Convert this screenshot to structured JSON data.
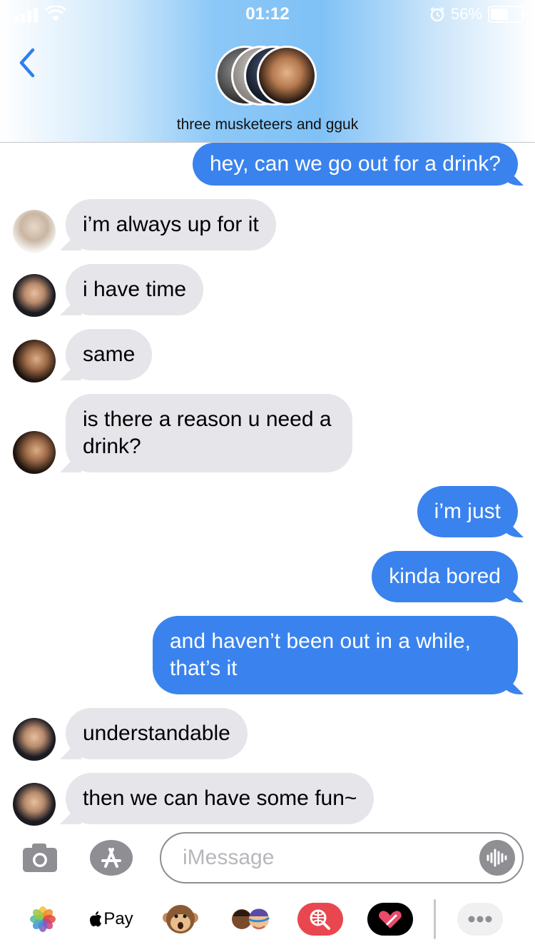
{
  "status_bar": {
    "time": "01:12",
    "battery_percent": "56%",
    "battery_level": 0.56
  },
  "header": {
    "group_title": "three musketeers and gguk"
  },
  "messages": [
    {
      "direction": "outgoing",
      "text": "hey, can we go out for a drink?"
    },
    {
      "direction": "incoming",
      "text": "i’m always up for it"
    },
    {
      "direction": "incoming",
      "text": "i have time"
    },
    {
      "direction": "incoming",
      "text": "same"
    },
    {
      "direction": "incoming",
      "text": "is there a reason u need a drink?"
    },
    {
      "direction": "outgoing",
      "text": "i’m just"
    },
    {
      "direction": "outgoing",
      "text": "kinda bored"
    },
    {
      "direction": "outgoing",
      "text": "and haven’t been out in a while, that’s it"
    },
    {
      "direction": "incoming",
      "text": "understandable"
    },
    {
      "direction": "incoming",
      "text": "then we can have some fun~"
    }
  ],
  "input_bar": {
    "placeholder": "iMessage",
    "value": ""
  },
  "app_drawer": {
    "apple_pay_label": "Pay",
    "icons": [
      "photos-icon",
      "apple-pay-icon",
      "monkey-animoji-icon",
      "memoji-icon",
      "web-search-icon",
      "digital-touch-icon",
      "more-icon"
    ]
  },
  "colors": {
    "outgoing_bubble": "#3a83ee",
    "incoming_bubble": "#e5e5ea",
    "header_accent": "#7fc1f6",
    "back_chevron": "#2f7ef0"
  }
}
